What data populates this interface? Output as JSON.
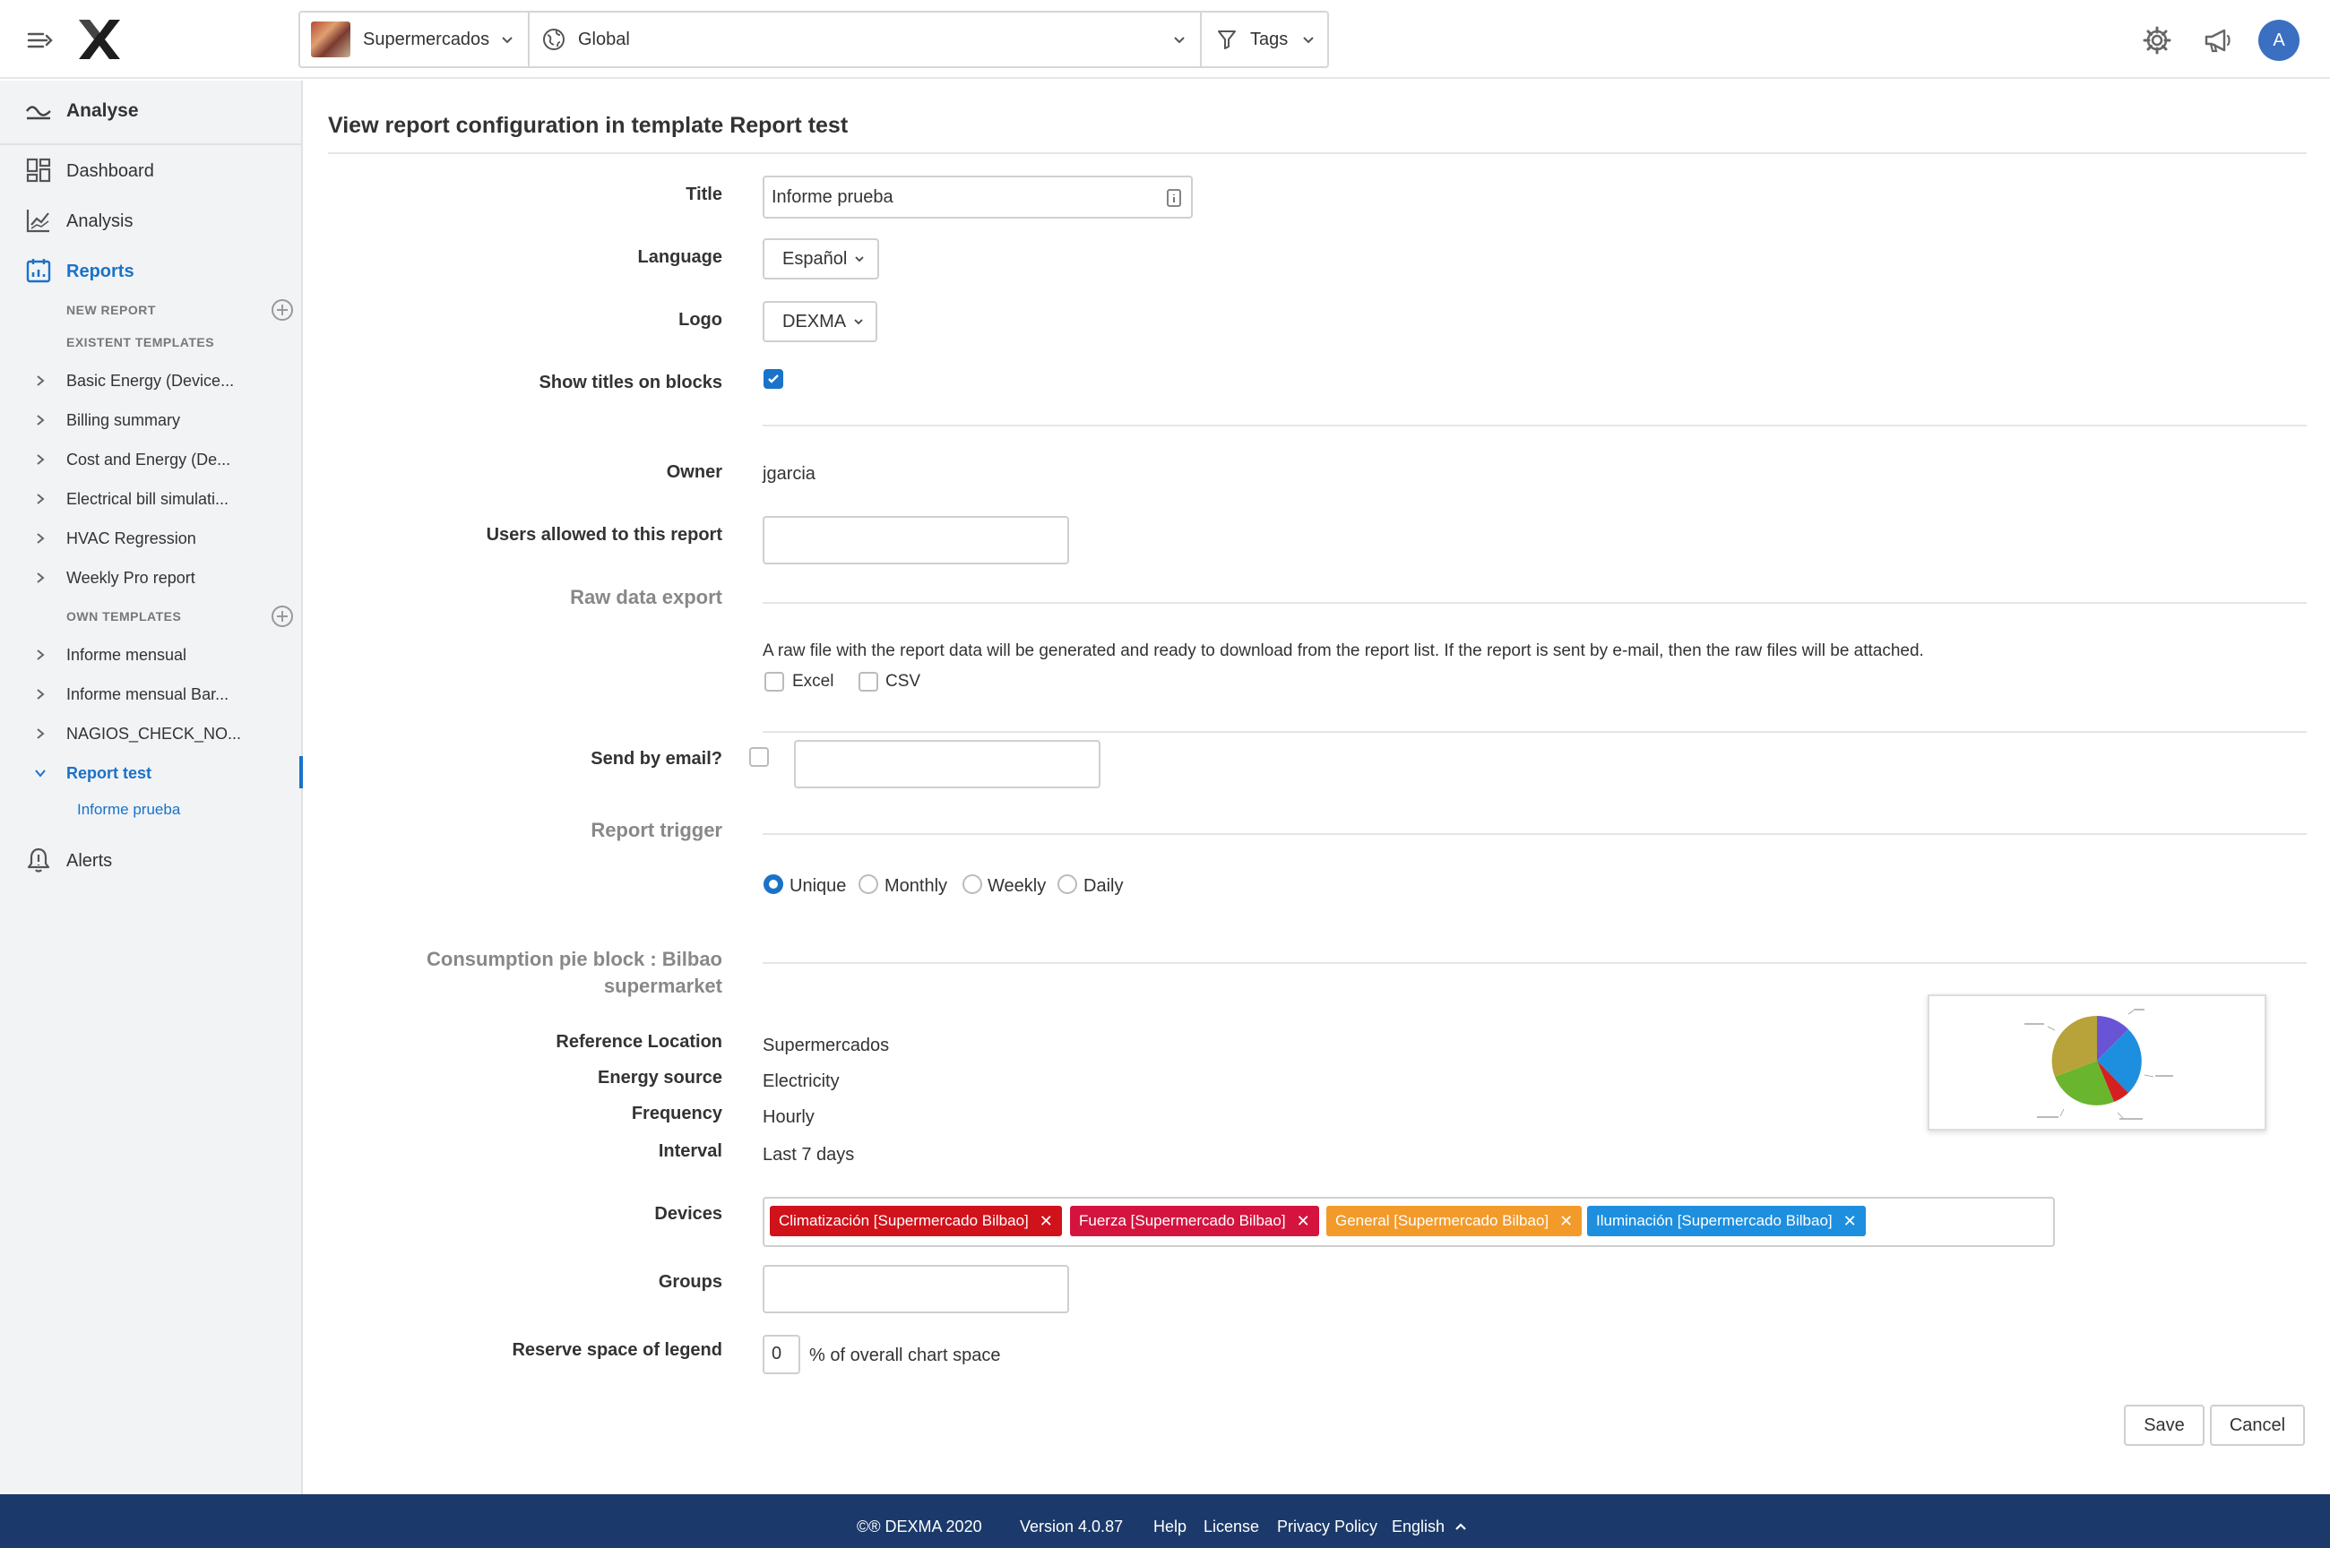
{
  "topbar": {
    "location": "Supermercados",
    "scope": "Global",
    "tags_label": "Tags",
    "avatar_initial": "A"
  },
  "sidebar": {
    "analyse_label": "Analyse",
    "dashboard_label": "Dashboard",
    "analysis_label": "Analysis",
    "reports_label": "Reports",
    "new_report_caption": "NEW REPORT",
    "existent_templates_caption": "EXISTENT TEMPLATES",
    "existent_templates": [
      "Basic Energy (Device...",
      "Billing summary",
      "Cost and Energy (De...",
      "Electrical bill simulati...",
      "HVAC Regression",
      "Weekly Pro report"
    ],
    "own_templates_caption": "OWN TEMPLATES",
    "own_templates": [
      "Informe mensual",
      "Informe mensual Bar...",
      "NAGIOS_CHECK_NO...",
      "Report test"
    ],
    "active_subreport": "Informe prueba",
    "alerts_label": "Alerts"
  },
  "form": {
    "page_title": "View report configuration in template Report test",
    "title_label": "Title",
    "title_value": "Informe prueba",
    "language_label": "Language",
    "language_value": "Español",
    "logo_label": "Logo",
    "logo_value": "DEXMA",
    "show_titles_label": "Show titles on blocks",
    "show_titles_checked": true,
    "owner_label": "Owner",
    "owner_value": "jgarcia",
    "users_label": "Users allowed to this report",
    "users_value": "",
    "raw_export_section": "Raw data export",
    "raw_export_desc": "A raw file with the report data will be generated and ready to download from the report list. If the report is sent by e-mail, then the raw files will be attached.",
    "excel_label": "Excel",
    "csv_label": "CSV",
    "send_email_label": "Send by email?",
    "email_value": "",
    "trigger_section": "Report trigger",
    "trigger_options": [
      "Unique",
      "Monthly",
      "Weekly",
      "Daily"
    ],
    "trigger_selected": "Unique",
    "block_section_line1": "Consumption pie block : Bilbao",
    "block_section_line2": "supermarket",
    "ref_location_label": "Reference Location",
    "ref_location_value": "Supermercados",
    "energy_source_label": "Energy source",
    "energy_source_value": "Electricity",
    "frequency_label": "Frequency",
    "frequency_value": "Hourly",
    "interval_label": "Interval",
    "interval_value": "Last 7 days",
    "devices_label": "Devices",
    "devices": [
      {
        "label": "Climatización [Supermercado Bilbao]",
        "color": "#d0121b"
      },
      {
        "label": "Fuerza [Supermercado Bilbao]",
        "color": "#d4143f"
      },
      {
        "label": "General [Supermercado Bilbao]",
        "color": "#f29b2b"
      },
      {
        "label": "Iluminación [Supermercado Bilbao]",
        "color": "#1d8fde"
      }
    ],
    "groups_label": "Groups",
    "groups_value": "",
    "legend_label": "Reserve space of legend",
    "legend_value": "0",
    "legend_suffix": "% of overall chart space",
    "save_label": "Save",
    "cancel_label": "Cancel"
  },
  "footer": {
    "copyright": "©® DEXMA 2020",
    "version": "Version 4.0.87",
    "help": "Help",
    "license": "License",
    "privacy": "Privacy Policy",
    "language": "English"
  },
  "colors": {
    "accent": "#1a72c9",
    "footer_bg": "#1b3a6b",
    "sidebar_bg": "#f2f3f5"
  }
}
